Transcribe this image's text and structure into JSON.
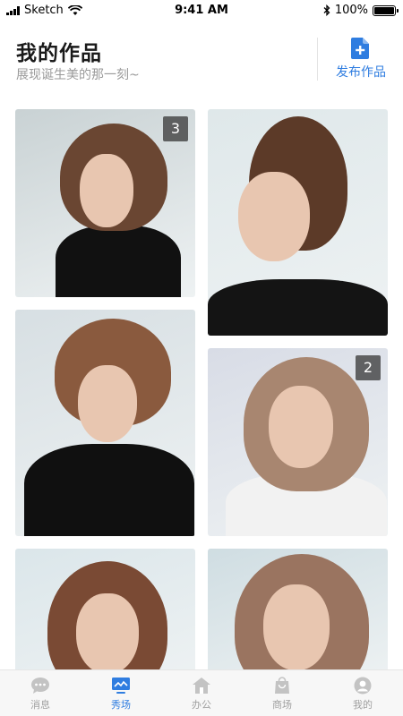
{
  "status_bar": {
    "carrier": "Sketch",
    "time": "9:41 AM",
    "battery": "100%",
    "battery_level": 1.0
  },
  "header": {
    "title": "我的作品",
    "subtitle": "展现诞生美的那一刻~",
    "publish_label": "发布作品"
  },
  "works": [
    {
      "count": "3",
      "hair_color": "#6a4632",
      "bg": "#c9d2d4"
    },
    {
      "count": "",
      "hair_color": "#5c3a28",
      "bg": "#dfe8ea"
    },
    {
      "count": "",
      "hair_color": "#8a5a3e",
      "bg": "#d7dfe3"
    },
    {
      "count": "2",
      "hair_color": "#a88670",
      "bg": "#d8dce6"
    },
    {
      "count": "",
      "hair_color": "#7a4a34",
      "bg": "#dbe6ea"
    },
    {
      "count": "",
      "hair_color": "#9a7460",
      "bg": "#cfdde2"
    }
  ],
  "tabs": [
    {
      "label": "消息",
      "icon": "chat-icon"
    },
    {
      "label": "秀场",
      "icon": "showcase-icon"
    },
    {
      "label": "办公",
      "icon": "office-icon"
    },
    {
      "label": "商场",
      "icon": "shop-bag-icon"
    },
    {
      "label": "我的",
      "icon": "profile-icon"
    }
  ],
  "colors": {
    "accent": "#2f7de0",
    "tab_inactive": "#a0a0a0"
  }
}
